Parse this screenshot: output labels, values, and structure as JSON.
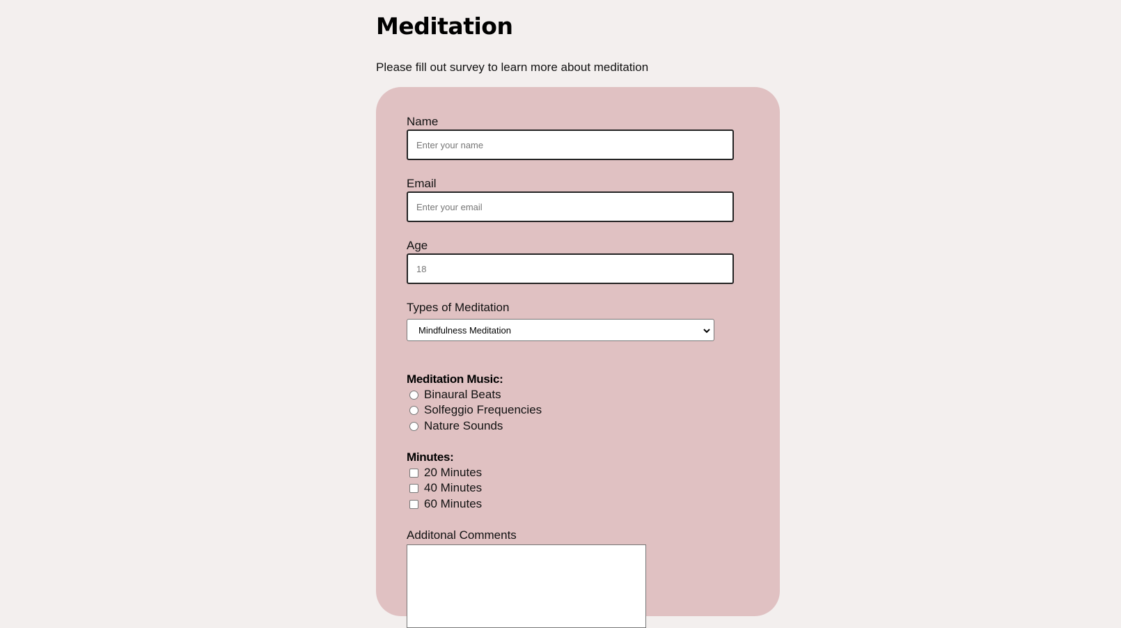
{
  "header": {
    "title": "Meditation",
    "description": "Please fill out survey to learn more about meditation"
  },
  "form": {
    "name": {
      "label": "Name",
      "placeholder": "Enter your name"
    },
    "email": {
      "label": "Email",
      "placeholder": "Enter your email"
    },
    "age": {
      "label": "Age",
      "placeholder": "18"
    },
    "types": {
      "label": "Types of Meditation",
      "selected": "Mindfulness Meditation"
    },
    "music": {
      "title": "Meditation Music:",
      "options": [
        "Binaural Beats",
        "Solfeggio Frequencies",
        "Nature Sounds"
      ]
    },
    "minutes": {
      "title": "Minutes:",
      "options": [
        "20 Minutes",
        "40 Minutes",
        "60 Minutes"
      ]
    },
    "comments": {
      "label": "Additonal Comments"
    }
  },
  "colors": {
    "background": "#f3efee",
    "card": "#e0c1c2"
  },
  "icons": {
    "select_caret": "chevron-down-icon"
  }
}
